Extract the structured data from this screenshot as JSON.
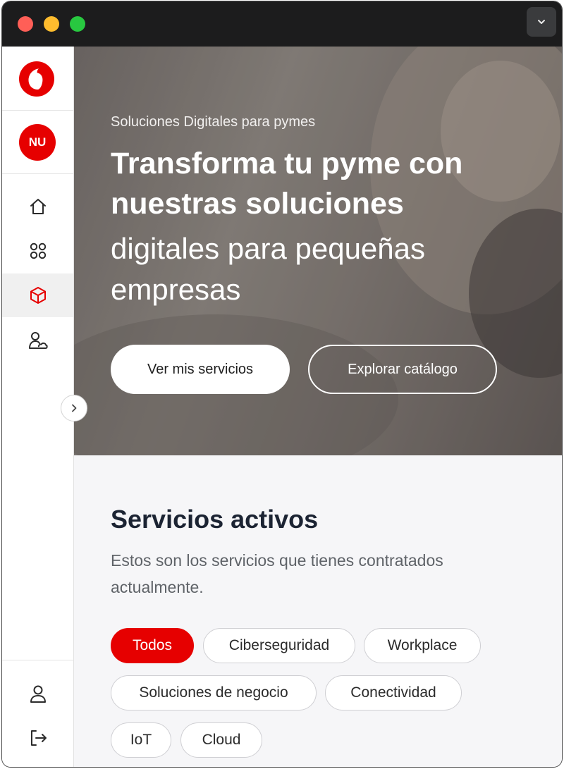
{
  "window": {
    "controls": [
      "close",
      "minimize",
      "maximize"
    ],
    "menu_icon": "chevron-down-icon"
  },
  "sidebar": {
    "logo_icon": "vodafone-logo-icon",
    "avatar_initials": "NU",
    "nav_items": [
      {
        "name": "home",
        "icon": "home-icon",
        "active": false
      },
      {
        "name": "apps",
        "icon": "apps-grid-icon",
        "active": false
      },
      {
        "name": "products",
        "icon": "cube-icon",
        "active": true
      },
      {
        "name": "user-cloud",
        "icon": "user-cloud-icon",
        "active": false
      }
    ],
    "bottom_items": [
      {
        "name": "profile",
        "icon": "user-icon"
      },
      {
        "name": "logout",
        "icon": "logout-icon"
      }
    ],
    "collapse_icon": "chevron-right-icon"
  },
  "hero": {
    "subtitle": "Soluciones Digitales para pymes",
    "title_bold": "Transforma tu pyme con nuestras soluciones",
    "title_regular": "digitales para pequeñas empresas",
    "primary_button": "Ver mis servicios",
    "secondary_button": "Explorar catálogo"
  },
  "services": {
    "title": "Servicios activos",
    "description": "Estos son los servicios que tienes contratados actualmente.",
    "filters": [
      {
        "label": "Todos",
        "active": true
      },
      {
        "label": "Ciberseguridad",
        "active": false
      },
      {
        "label": "Workplace",
        "active": false
      },
      {
        "label": "Soluciones de negocio",
        "active": false
      },
      {
        "label": "Conectividad",
        "active": false
      },
      {
        "label": "IoT",
        "active": false
      },
      {
        "label": "Cloud",
        "active": false
      }
    ]
  },
  "colors": {
    "brand_red": "#e60000",
    "titlebar": "#1c1c1d",
    "content_bg": "#f6f6f8"
  }
}
